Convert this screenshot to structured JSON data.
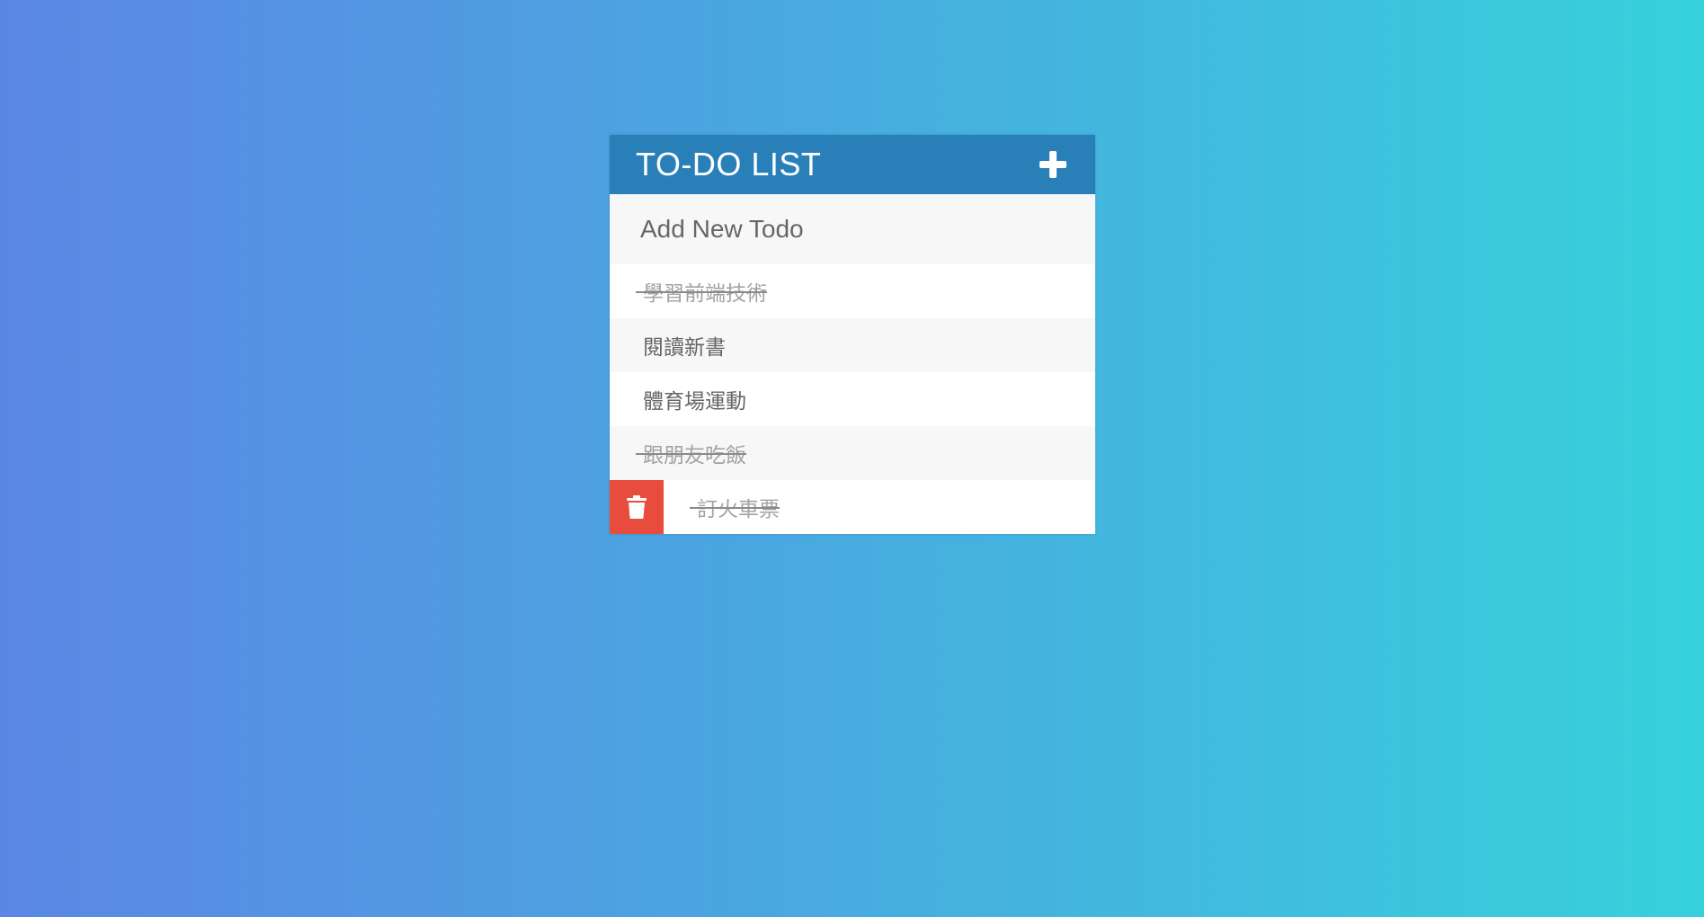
{
  "header": {
    "title": "TO-DO LIST",
    "add_icon": "plus-icon"
  },
  "new_todo": {
    "placeholder": "Add New Todo",
    "value": ""
  },
  "todos": [
    {
      "text": "學習前端技術",
      "completed": true,
      "hovered": false
    },
    {
      "text": "閱讀新書",
      "completed": false,
      "hovered": false
    },
    {
      "text": "體育場運動",
      "completed": false,
      "hovered": false
    },
    {
      "text": "跟朋友吃飯",
      "completed": true,
      "hovered": false
    },
    {
      "text": "訂火車票",
      "completed": true,
      "hovered": true
    }
  ],
  "colors": {
    "header": "#2980b9",
    "delete": "#e74c3c",
    "background_start": "#5b86e5",
    "background_end": "#36d1dc"
  }
}
